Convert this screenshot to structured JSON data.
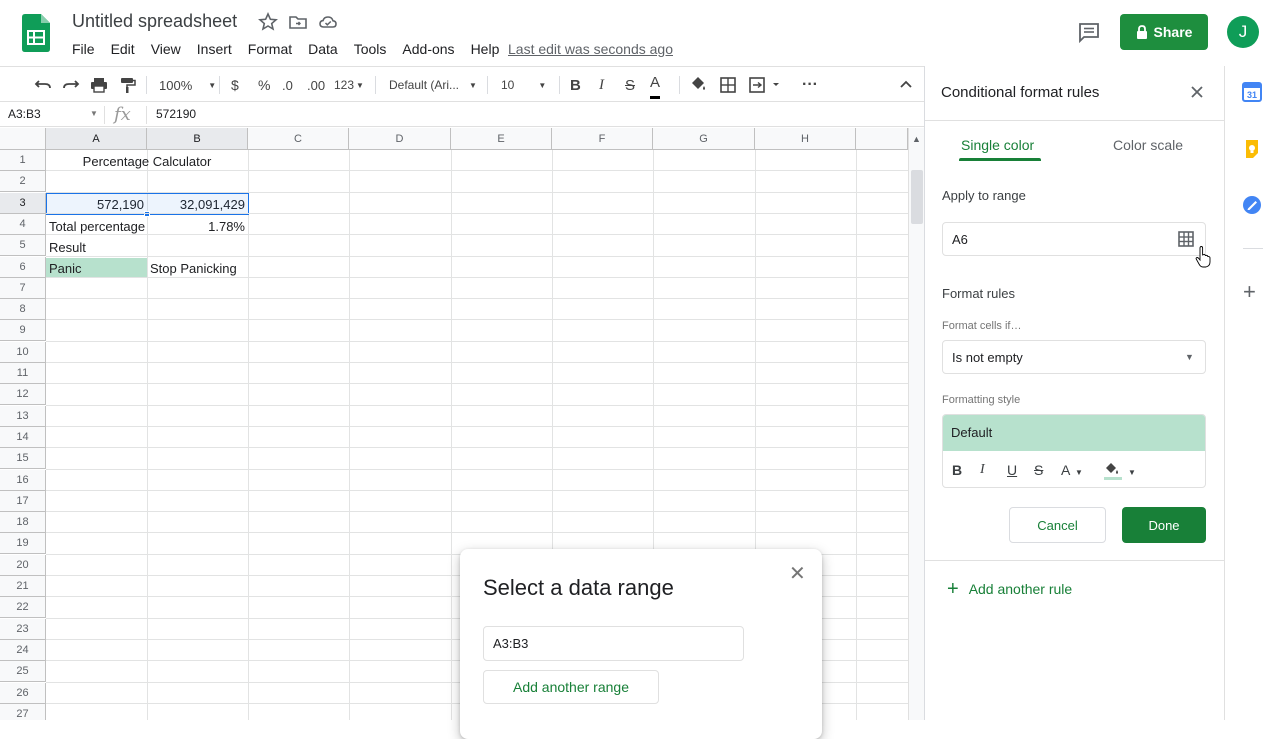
{
  "header": {
    "doc_title": "Untitled spreadsheet",
    "menu": [
      "File",
      "Edit",
      "View",
      "Insert",
      "Format",
      "Data",
      "Tools",
      "Add-ons",
      "Help"
    ],
    "last_edit": "Last edit was seconds ago",
    "share_label": "Share",
    "avatar_initial": "J"
  },
  "toolbar": {
    "zoom": "100%",
    "currency": "$",
    "percent": "%",
    "decrease_decimal": ".0",
    "increase_decimal": ".00",
    "more_formats": "123",
    "font": "Default (Ari...",
    "font_size": "10",
    "bold": "B",
    "italic": "I",
    "strike": "S",
    "text_color": "A",
    "more": "···"
  },
  "formula_bar": {
    "name_box": "A3:B3",
    "fx": "fx",
    "value": "572190"
  },
  "grid": {
    "columns": [
      "A",
      "B",
      "C",
      "D",
      "E",
      "F",
      "G",
      "H"
    ],
    "rows": [
      "1",
      "2",
      "3",
      "4",
      "5",
      "6",
      "7",
      "8",
      "9",
      "10",
      "11",
      "12",
      "13",
      "14",
      "15",
      "16",
      "17",
      "18",
      "19",
      "20",
      "21",
      "22",
      "23",
      "24",
      "25",
      "26",
      "27"
    ],
    "cells": {
      "A1": "Percentage Calculator",
      "A3": "572,190",
      "B3": "32,091,429",
      "A4": "Total percentage",
      "B4": "1.78%",
      "A5": "Result",
      "A6": "Panic",
      "B6": "Stop Panicking"
    },
    "highlight_color": "#b7e1cd",
    "selection_color": "#1a73e8"
  },
  "panel": {
    "title": "Conditional format rules",
    "tabs": [
      "Single color",
      "Color scale"
    ],
    "apply_to_range_label": "Apply to range",
    "apply_to_range_value": "A6",
    "format_rules_label": "Format rules",
    "format_cells_if_label": "Format cells if…",
    "condition": "Is not empty",
    "formatting_style_label": "Formatting style",
    "style_preview": "Default",
    "style_buttons": [
      "B",
      "I",
      "U",
      "S",
      "A"
    ],
    "cancel_label": "Cancel",
    "done_label": "Done",
    "add_rule_label": "Add another rule",
    "accent_color": "#188038"
  },
  "dialog": {
    "title": "Select a data range",
    "range_value": "A3:B3",
    "add_range_label": "Add another range"
  }
}
